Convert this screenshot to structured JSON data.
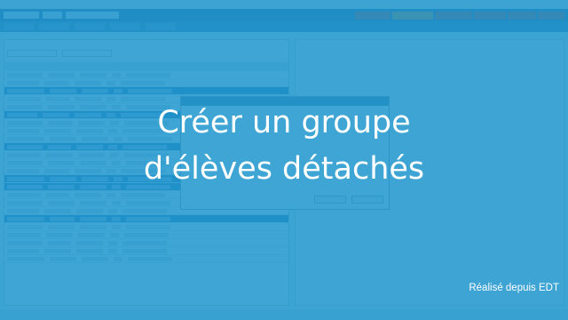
{
  "title": {
    "line1": "Créer un groupe",
    "line2": "d'élèves détachés"
  },
  "credit": "Réalisé depuis EDT",
  "colors": {
    "overlay": "#1e96cd",
    "text": "#ffffff"
  }
}
